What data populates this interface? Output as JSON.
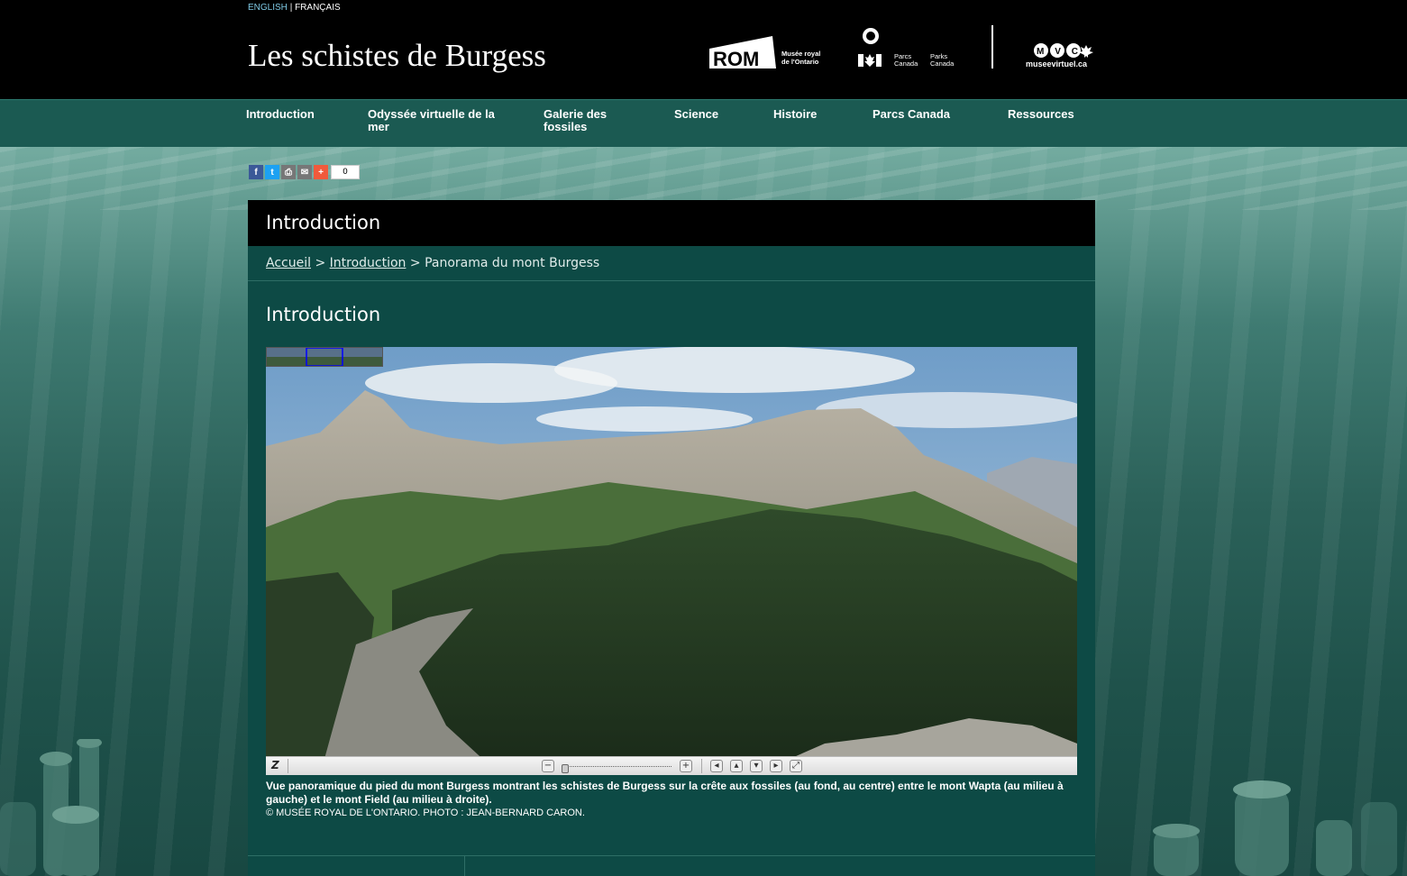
{
  "language": {
    "english": "ENGLISH",
    "separator": "|",
    "french": "FRANÇAIS"
  },
  "header": {
    "site_title": "Les schistes de Burgess",
    "rom_logo": {
      "mark": "ROM",
      "text_line1": "Musée royal",
      "text_line2": "de l'Ontario"
    },
    "parks_logo": {
      "fr1": "Parcs",
      "fr2": "Canada",
      "en1": "Parks",
      "en2": "Canada"
    },
    "mvc_logo": {
      "mark": "MVC",
      "text": "museevirtuel.ca"
    }
  },
  "nav": {
    "items": [
      {
        "label": "Introduction"
      },
      {
        "label": "Odyssée virtuelle de la mer"
      },
      {
        "label": "Galerie des fossiles"
      },
      {
        "label": "Science"
      },
      {
        "label": "Histoire"
      },
      {
        "label": "Parcs Canada"
      },
      {
        "label": "Ressources"
      }
    ]
  },
  "share": {
    "count": "0",
    "icons": [
      "facebook-icon",
      "twitter-icon",
      "print-icon",
      "email-icon",
      "more-icon"
    ]
  },
  "page": {
    "heading": "Introduction",
    "breadcrumb": {
      "home": "Accueil",
      "sep1": ">",
      "section": "Introduction",
      "sep2": ">",
      "current": "Panorama du mont Burgess"
    },
    "section_title": "Introduction",
    "caption": "Vue panoramique du pied du mont Burgess montrant les schistes de Burgess sur la crête aux fossiles (au fond, au centre) entre le mont Wapta (au milieu à gauche) et le mont Field (au milieu à droite).",
    "credit": "© MUSÉE ROYAL DE L'ONTARIO. PHOTO : JEAN-BERNARD CARON."
  },
  "viewer": {
    "logo": "Z",
    "zoom_out": "−",
    "zoom_in": "+"
  },
  "colors": {
    "header_bg": "#000000",
    "nav_bg": "#1b5a52",
    "content_bg": "#0d4a45",
    "link_lang": "#7ec8e3"
  }
}
